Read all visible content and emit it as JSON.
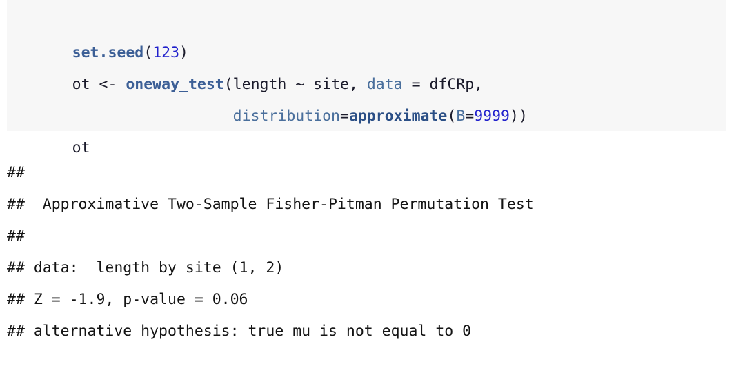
{
  "document": {
    "background_color": "#ffffff",
    "kind": "r-markdown-knitted-output"
  },
  "code_block": {
    "background_color": "#f7f7f7",
    "language": "R",
    "colors": {
      "function": "#3c5f96",
      "argument": "#4a6f9c",
      "number": "#2121cc",
      "plain": "#1b1b2b"
    },
    "lines": [
      {
        "id": "line-1",
        "plain_text": "set.seed(123)",
        "tokens": [
          {
            "t": "set.seed",
            "k": "fn"
          },
          {
            "t": "(",
            "k": "punct"
          },
          {
            "t": "123",
            "k": "num"
          },
          {
            "t": ")",
            "k": "punct"
          }
        ]
      },
      {
        "id": "line-2",
        "plain_text": "ot <- oneway_test(length ~ site, data = dfCRp,",
        "tokens": [
          {
            "t": "ot <- ",
            "k": "plain"
          },
          {
            "t": "oneway_test",
            "k": "fn"
          },
          {
            "t": "(length ~ site, ",
            "k": "plain"
          },
          {
            "t": "data",
            "k": "arg"
          },
          {
            "t": " = dfCRp,",
            "k": "plain"
          }
        ]
      },
      {
        "id": "line-3",
        "plain_text": "                  distribution=approximate(B=9999))",
        "tokens": [
          {
            "t": "                  ",
            "k": "plain"
          },
          {
            "t": "distribution",
            "k": "arg"
          },
          {
            "t": "=",
            "k": "plain"
          },
          {
            "t": "approximate",
            "k": "fn"
          },
          {
            "t": "(",
            "k": "punct"
          },
          {
            "t": "B",
            "k": "arg"
          },
          {
            "t": "=",
            "k": "plain"
          },
          {
            "t": "9999",
            "k": "num"
          },
          {
            "t": "))",
            "k": "punct"
          }
        ]
      },
      {
        "id": "line-4",
        "plain_text": "ot",
        "tokens": [
          {
            "t": "ot",
            "k": "plain"
          }
        ]
      }
    ]
  },
  "output_block": {
    "text_color": "#141414",
    "lines": [
      {
        "id": "out-1",
        "text": "## "
      },
      {
        "id": "out-2",
        "text": "##  Approximative Two-Sample Fisher-Pitman Permutation Test"
      },
      {
        "id": "out-3",
        "text": "## "
      },
      {
        "id": "out-4",
        "text": "## data:  length by site (1, 2)"
      },
      {
        "id": "out-5",
        "text": "## Z = -1.9, p-value = 0.06"
      },
      {
        "id": "out-6",
        "text": "## alternative hypothesis: true mu is not equal to 0"
      }
    ],
    "results": {
      "test_name": "Approximative Two-Sample Fisher-Pitman Permutation Test",
      "data_description": "length by site (1, 2)",
      "Z": "-1.9",
      "p_value": "0.06",
      "alternative_hypothesis": "true mu is not equal to 0"
    }
  }
}
